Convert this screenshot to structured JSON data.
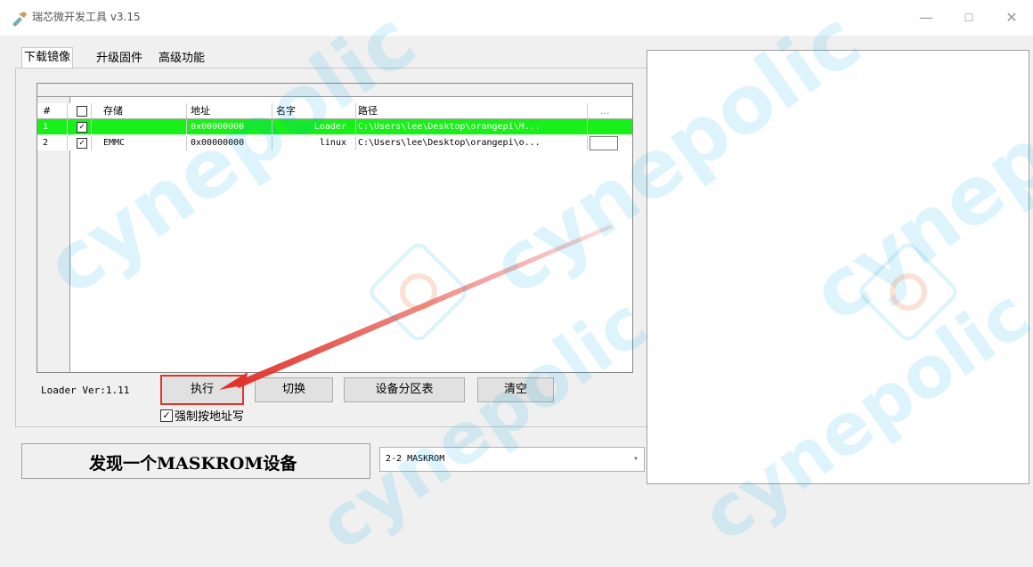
{
  "window": {
    "title": "瑞芯微开发工具 v3.15",
    "min_label": "—",
    "max_label": "☐",
    "close_label": "✕"
  },
  "tabs": [
    {
      "label": "下载镜像",
      "active": true
    },
    {
      "label": "升级固件",
      "active": false
    },
    {
      "label": "高级功能",
      "active": false
    }
  ],
  "table": {
    "columns": [
      "#",
      "",
      "存储",
      "地址",
      "名字",
      "路径",
      "..."
    ],
    "rows": [
      {
        "index": "1",
        "checked": true,
        "storage": "",
        "address": "0x00000000",
        "name": "Loader",
        "path": "C:\\Users\\lee\\Desktop\\orangepi\\M...",
        "selected": true
      },
      {
        "index": "2",
        "checked": true,
        "storage": "EMMC",
        "address": "0x00000000",
        "name": "linux",
        "path": "C:\\Users\\lee\\Desktop\\orangepi\\o...",
        "selected": false
      }
    ]
  },
  "loader_version": "Loader Ver:1.11",
  "buttons": {
    "execute": "执行",
    "switch": "切换",
    "partition_table": "设备分区表",
    "clear": "清空"
  },
  "force_address": {
    "checked": true,
    "label": "强制按地址写"
  },
  "status": {
    "text": "发现一个MASKROM设备"
  },
  "device_select": {
    "value": "2-2  MASKROM"
  },
  "watermark": {
    "text": "cynepolic"
  },
  "colors": {
    "selected_row": "#19ef19",
    "highlight": "#e0342c"
  }
}
